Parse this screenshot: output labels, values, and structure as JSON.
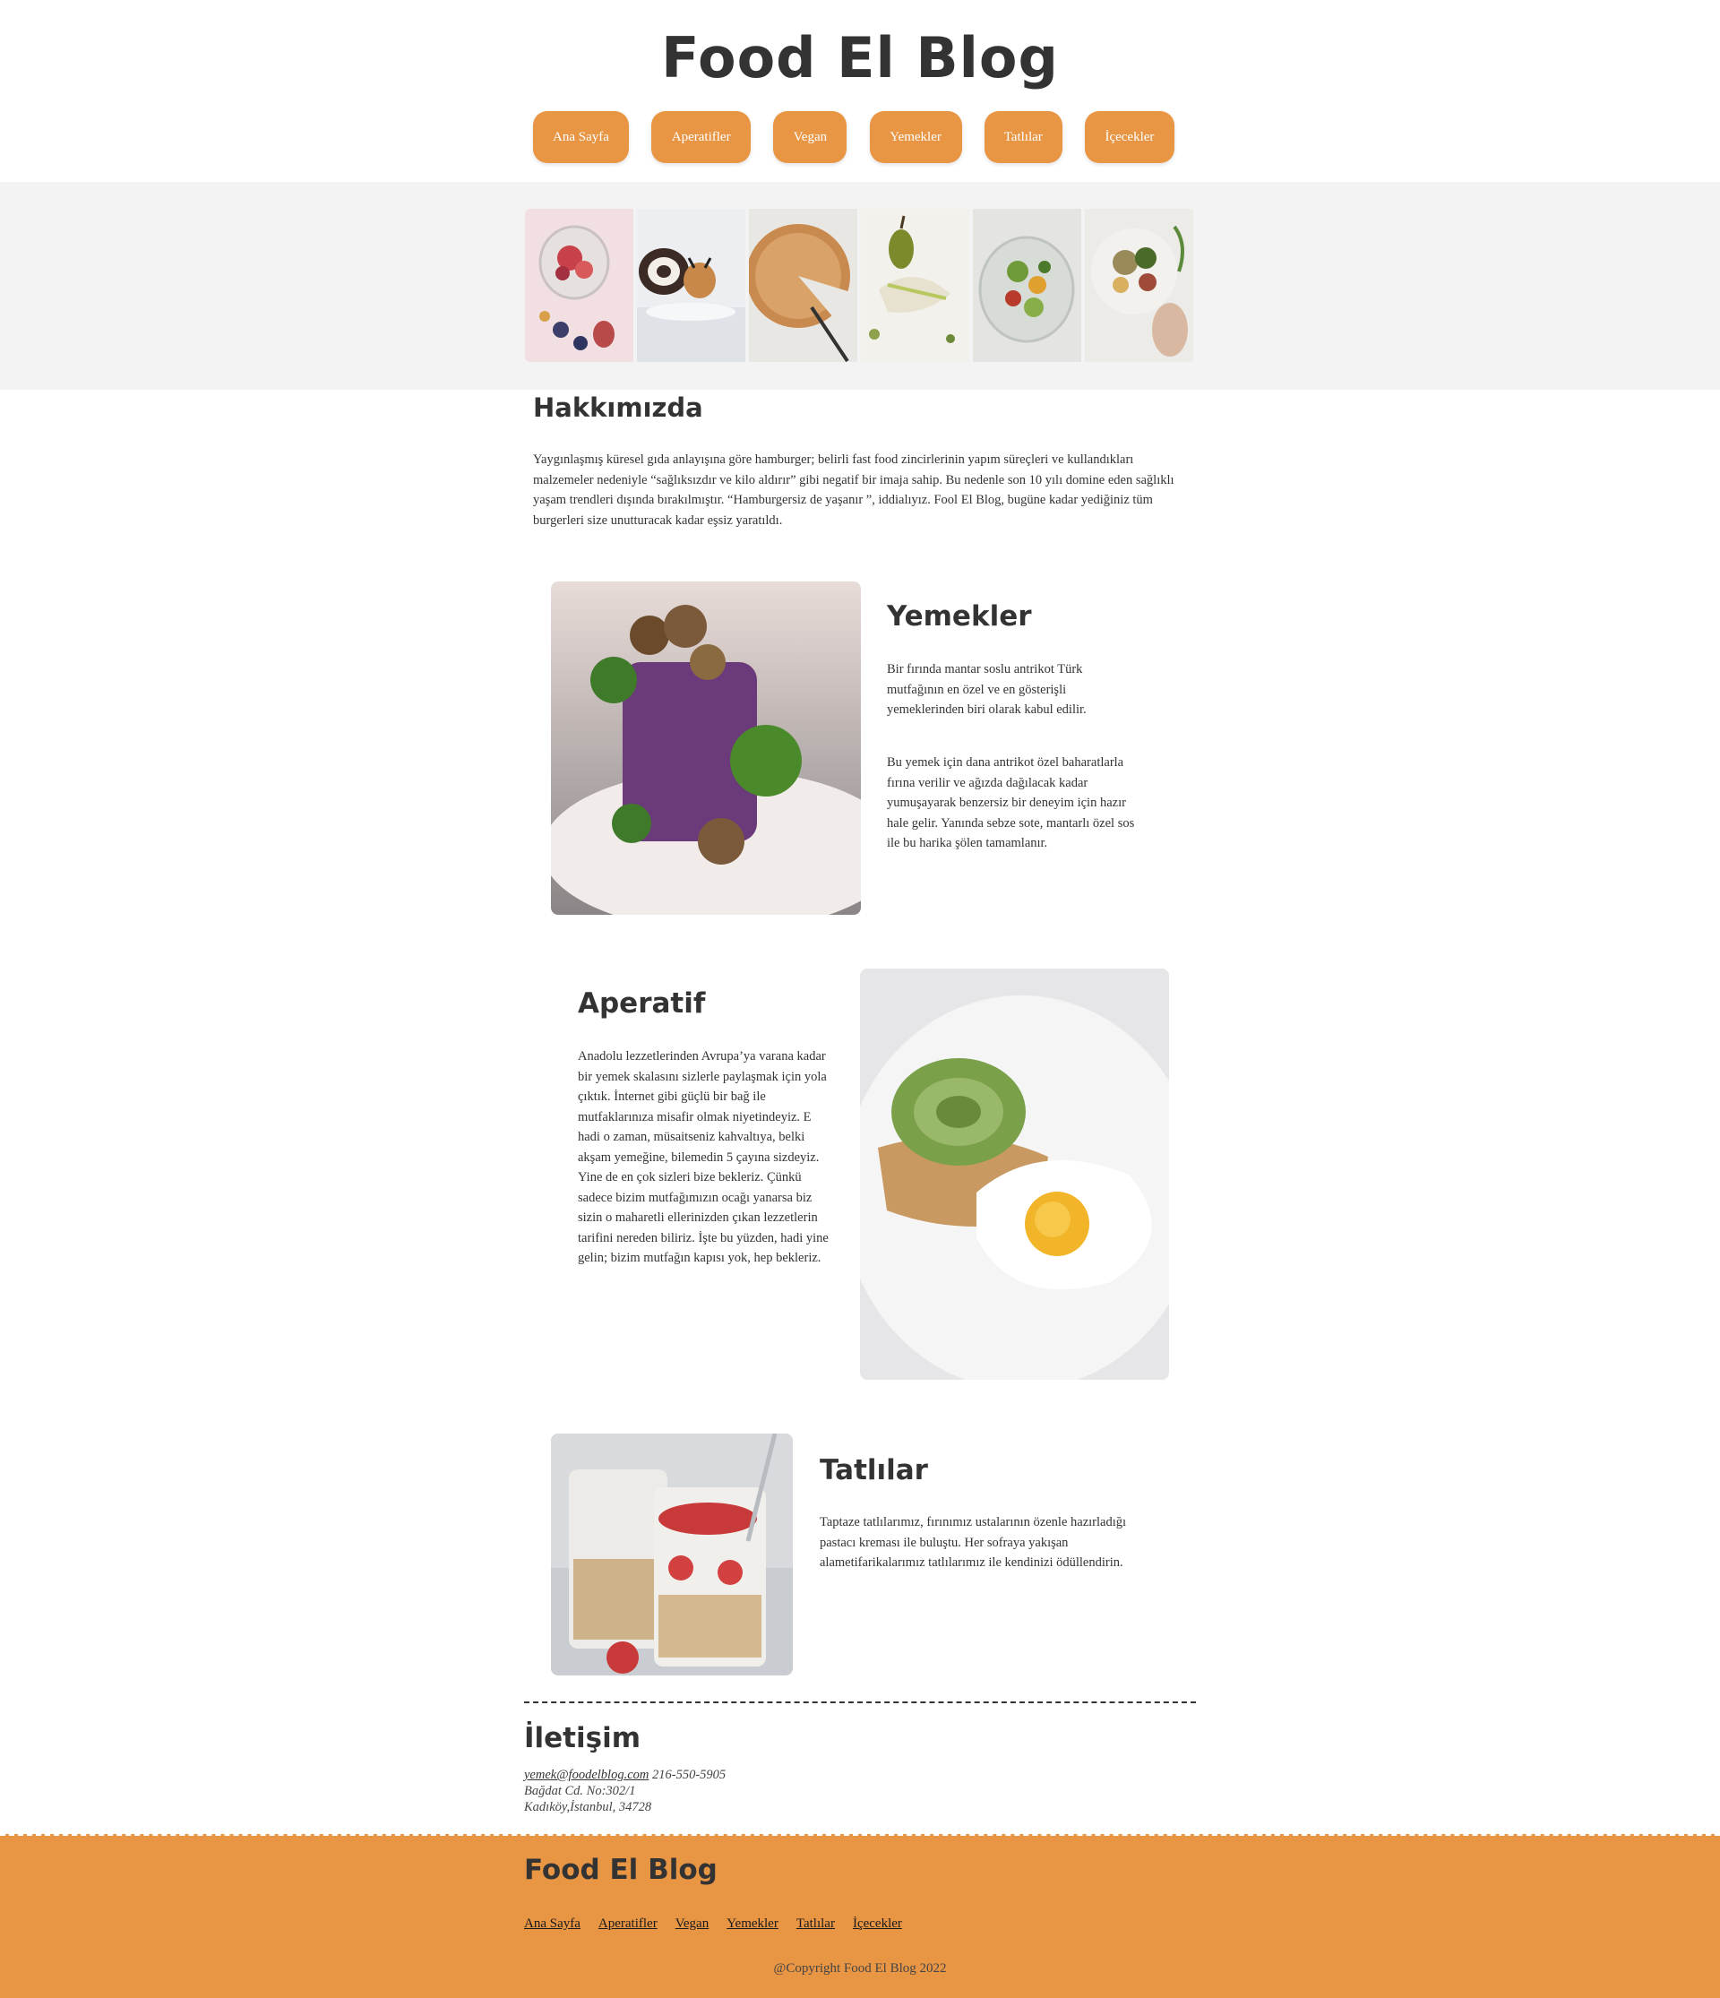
{
  "header": {
    "title": "Food El Blog",
    "nav": [
      "Ana Sayfa",
      "Aperatifler",
      "Vegan",
      "Yemekler",
      "Tatlılar",
      "İçecekler"
    ]
  },
  "gallery": {
    "images": [
      "fruit-jar-image",
      "cake-roll-image",
      "pie-image",
      "pear-salad-image",
      "salad-bowl-image",
      "grain-bowl-image"
    ]
  },
  "about": {
    "title": "Hakkımızda",
    "text": "Yaygınlaşmış küresel gıda anlayışına göre hamburger; belirli fast food zincirlerinin yapım süreçleri ve kullandıkları malzemeler nedeniyle “sağlıksızdır ve kilo aldırır” gibi negatif bir imaja sahip. Bu nedenle son 10 yılı domine eden sağlıklı yaşam trendleri dışında bırakılmıştır. “Hamburgersiz de yaşanır ”, iddialıyız. Fool El Blog, bugüne kadar yediğiniz tüm burgerleri size unutturacak kadar eşsiz yaratıldı."
  },
  "yemekler": {
    "title": "Yemekler",
    "text1": "Bir fırında mantar soslu antrikot Türk mutfağının en özel ve en gösterişli yemeklerinden biri olarak kabul edilir.",
    "text2": "Bu yemek için dana antrikot özel baharatlarla fırına verilir ve ağızda dağılacak kadar yumuşayarak benzersiz bir deneyim için hazır hale gelir. Yanında sebze sote, mantarlı özel sos ile bu harika şölen tamamlanır."
  },
  "aperatif": {
    "title": "Aperatif",
    "text": "Anadolu lezzetlerinden Avrupa’ya varana kadar bir yemek skalasını sizlerle paylaşmak için yola çıktık. İnternet gibi güçlü bir bağ ile mutfaklarınıza misafir olmak niyetindeyiz. E hadi o zaman, müsaitseniz kahvaltıya, belki akşam yemeğine, bilemedin 5 çayına sizdeyiz. Yine de en çok sizleri bize bekleriz. Çünkü sadece bizim mutfağımızın ocağı yanarsa biz sizin o maharetli ellerinizden çıkan lezzetlerin tarifini nereden biliriz. İşte bu yüzden, hadi yine gelin; bizim mutfağın kapısı yok, hep bekleriz."
  },
  "tatlilar": {
    "title": "Tatlılar",
    "text": "Taptaze tatlılarımız, fırınımız ustalarının özenle hazırladığı pastacı kreması ile buluştu. Her sofraya yakışan alametifarikalarımız tatlılarımız ile kendinizi ödüllendirin."
  },
  "contact": {
    "title": "İletişim",
    "email": "yemek@foodelblog.com",
    "phone": "216-550-5905",
    "address1": "Bağdat Cd. No:302/1",
    "address2": "Kadıköy,İstanbul, 34728"
  },
  "footer": {
    "title": "Food El Blog",
    "links": [
      "Ana Sayfa",
      "Aperatifler",
      "Vegan",
      "Yemekler",
      "Tatlılar",
      "İçecekler"
    ],
    "copyright": "@Copyright Food El Blog 2022"
  },
  "colors": {
    "accent": "#e89544",
    "text": "#333333",
    "band": "#f3f3f3"
  }
}
